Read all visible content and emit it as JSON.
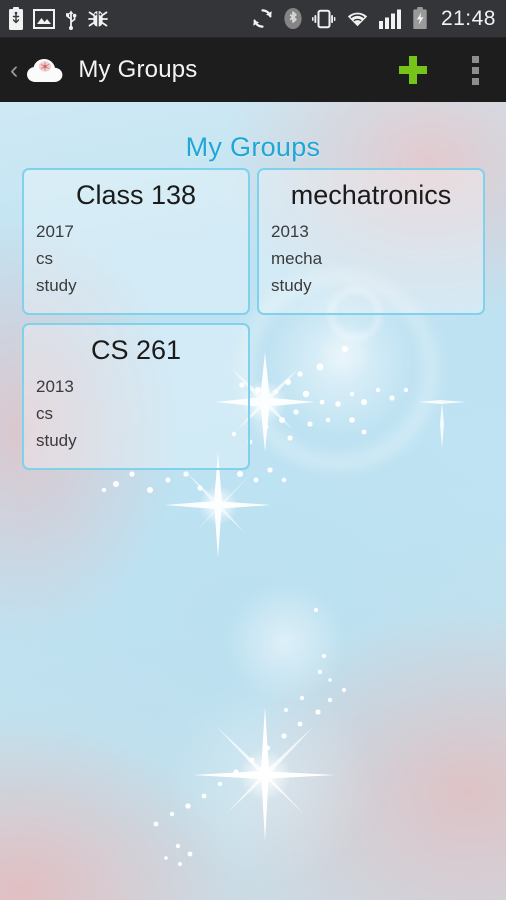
{
  "status_bar": {
    "icons_left": [
      {
        "name": "usb-battery-icon",
        "label": "usb-battery"
      },
      {
        "name": "screenshot-image-icon",
        "label": "image"
      },
      {
        "name": "usb-icon",
        "label": "usb"
      },
      {
        "name": "debug-bug-icon",
        "label": "adb-debug"
      }
    ],
    "icons_right": [
      {
        "name": "sync-icon",
        "label": "sync"
      },
      {
        "name": "bluetooth-icon",
        "label": "bluetooth"
      },
      {
        "name": "vibrate-icon",
        "label": "vibrate"
      },
      {
        "name": "wifi-icon",
        "label": "wifi"
      },
      {
        "name": "signal-bars-icon",
        "label": "signal"
      },
      {
        "name": "battery-charging-icon",
        "label": "battery-charging"
      }
    ],
    "clock": "21:48"
  },
  "action_bar": {
    "back_label": "‹",
    "app_icon": "cloud-icon",
    "title": "My Groups",
    "add_label": "+",
    "overflow_label": "more-options"
  },
  "page": {
    "heading": "My Groups"
  },
  "groups": [
    {
      "title": "Class 138",
      "year": "2017",
      "subject": "cs",
      "kind": "study"
    },
    {
      "title": "mechatronics",
      "year": "2013",
      "subject": "mecha",
      "kind": "study"
    },
    {
      "title": "CS 261",
      "year": "2013",
      "subject": "cs",
      "kind": "study"
    }
  ],
  "colors": {
    "accent_cyan": "#1fa7d6",
    "card_border": "#7fd2ea",
    "add_green": "#76c31a",
    "status_bar_bg": "#333538",
    "action_bar_bg": "#1d1d1d"
  }
}
